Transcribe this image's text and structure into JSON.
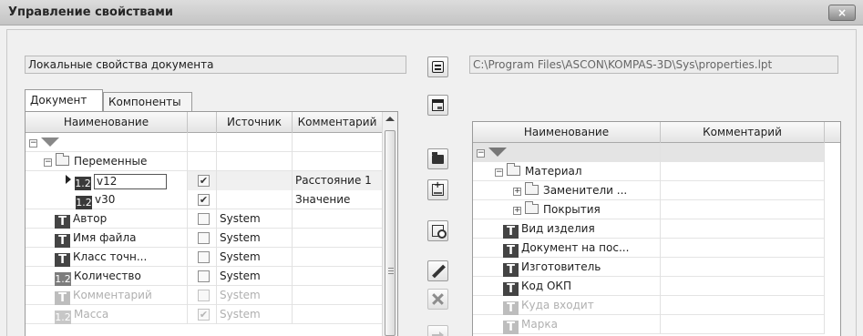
{
  "window": {
    "title": "Управление свойствами",
    "close_label": "×"
  },
  "left": {
    "path": "Локальные свойства документа",
    "tabs": [
      "Документ",
      "Компоненты"
    ],
    "columns": [
      "Наименование",
      "",
      "Источник",
      "Комментарий"
    ],
    "rows": [
      {
        "name": "",
        "checked": null,
        "source": "",
        "comment": ""
      },
      {
        "name": "Переменные",
        "checked": null,
        "source": "",
        "comment": ""
      },
      {
        "name": "v12",
        "badge": "1.2",
        "checked": true,
        "source": "",
        "comment": "Расстояние 1"
      },
      {
        "name": "v30",
        "badge": "1.2",
        "checked": true,
        "source": "",
        "comment": "Значение"
      },
      {
        "name": "Автор",
        "badge": "T",
        "checked": false,
        "source": "System",
        "comment": ""
      },
      {
        "name": "Имя файла",
        "badge": "T",
        "checked": false,
        "source": "System",
        "comment": ""
      },
      {
        "name": "Класс точн...",
        "badge": "T",
        "checked": false,
        "source": "System",
        "comment": ""
      },
      {
        "name": "Количество",
        "badge": "1.2",
        "checked": false,
        "source": "System",
        "comment": ""
      },
      {
        "name": "Комментарий",
        "badge": "T",
        "checked": false,
        "source": "System",
        "comment": ""
      },
      {
        "name": "Масса",
        "badge": "1.2",
        "checked": true,
        "source": "System",
        "comment": ""
      }
    ]
  },
  "right": {
    "path": "C:\\Program Files\\ASCON\\KOMPAS-3D\\Sys\\properties.lpt",
    "columns": [
      "Наименование",
      "Комментарий"
    ],
    "rows": [
      {
        "name": "",
        "comment": ""
      },
      {
        "name": "Материал",
        "comment": ""
      },
      {
        "name": "Заменители ...",
        "comment": ""
      },
      {
        "name": "Покрытия",
        "comment": ""
      },
      {
        "name": "Вид изделия",
        "badge": "T",
        "comment": ""
      },
      {
        "name": "Документ на пос...",
        "badge": "T",
        "comment": ""
      },
      {
        "name": "Изготовитель",
        "badge": "T",
        "comment": ""
      },
      {
        "name": "Код ОКП",
        "badge": "T",
        "comment": ""
      },
      {
        "name": "Куда входит",
        "badge": "T",
        "comment": ""
      },
      {
        "name": "Марка",
        "badge": "T",
        "comment": ""
      }
    ]
  },
  "toolbar": {
    "icons": [
      "properties-icon",
      "window-icon",
      "folder-icon",
      "dialog-icon",
      "search-icon",
      "pen-icon",
      "delete-icon",
      "arrow-right-icon"
    ]
  },
  "theme": {
    "selected_row": "#f0f0f0",
    "dim_text": "#b0b0b0"
  }
}
